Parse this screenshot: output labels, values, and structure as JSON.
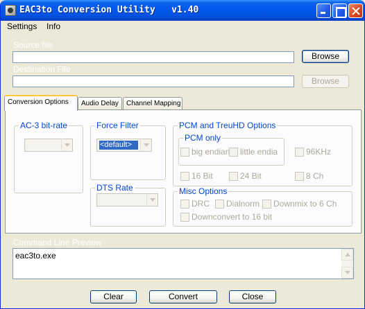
{
  "window": {
    "title": "EAC3to Conversion Utility   v1.40",
    "controls": [
      "minimize",
      "maximize",
      "close"
    ]
  },
  "menu": [
    "Settings",
    "Info"
  ],
  "source": {
    "label": "Source file",
    "value": "",
    "browse_label": "Browse"
  },
  "destination": {
    "label": "Destination File",
    "value": "",
    "browse_label": "Browse"
  },
  "tabs": [
    {
      "label": "Conversion Options",
      "active": true
    },
    {
      "label": "Audio Delay",
      "active": false
    },
    {
      "label": "Channel Mapping",
      "active": false
    }
  ],
  "conversion": {
    "ac3": {
      "legend": "AC-3 bit-rate",
      "value": ""
    },
    "force_filter": {
      "legend": "Force Filter",
      "value": "<default>"
    },
    "dts_rate": {
      "legend": "DTS Rate",
      "value": ""
    },
    "pcm_truehd": {
      "legend": "PCM and TreuHD Options",
      "pcm_only": {
        "legend": "PCM only",
        "options": [
          "big endian",
          "little endia"
        ]
      },
      "options": [
        "96KHz",
        "16 Bit",
        "24 Bit",
        "8 Ch"
      ]
    },
    "misc": {
      "legend": "Misc Options",
      "options": [
        "DRC",
        "Dialnorm",
        "Downmix to 6 Ch",
        "Downconvert to 16 bit"
      ]
    }
  },
  "command_preview": {
    "label": "Command Line Preview",
    "text": "eac3to.exe"
  },
  "buttons": {
    "clear": "Clear",
    "convert": "Convert",
    "close": "Close"
  },
  "colors": {
    "title_bar": "#0058ee",
    "group_legend": "#0046d5",
    "selection": "#316ac5",
    "window_bg": "#ece9d8"
  }
}
